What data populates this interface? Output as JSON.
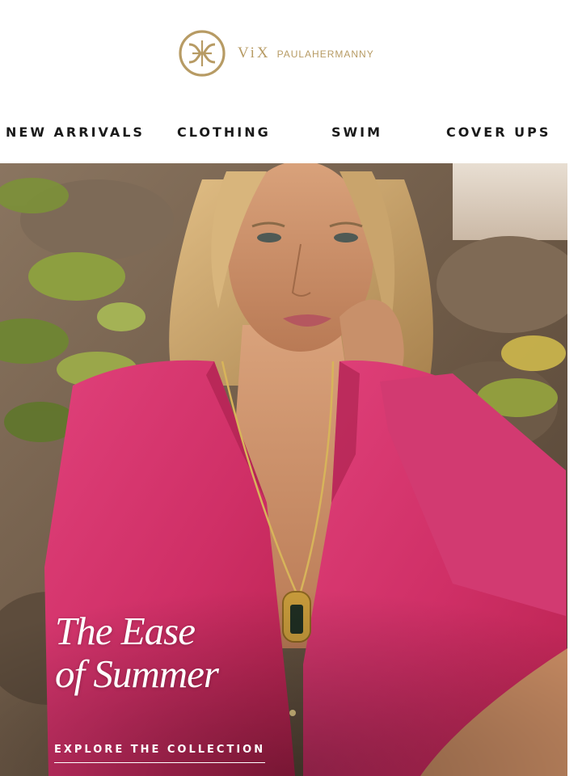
{
  "brand": {
    "name_primary": "ViX",
    "name_secondary": "PAULAHERMANNY",
    "color": "#b79b64",
    "logo_icon": "vix-monogram-icon"
  },
  "nav": {
    "items": [
      {
        "label": "NEW ARRIVALS"
      },
      {
        "label": "CLOTHING"
      },
      {
        "label": "SWIM"
      },
      {
        "label": "COVER UPS"
      }
    ]
  },
  "hero": {
    "headline_line1": "The Ease",
    "headline_line2": "of Summer",
    "cta_label": "EXPLORE THE COLLECTION",
    "dress_color": "#d4326a",
    "text_color": "#ffffff"
  }
}
